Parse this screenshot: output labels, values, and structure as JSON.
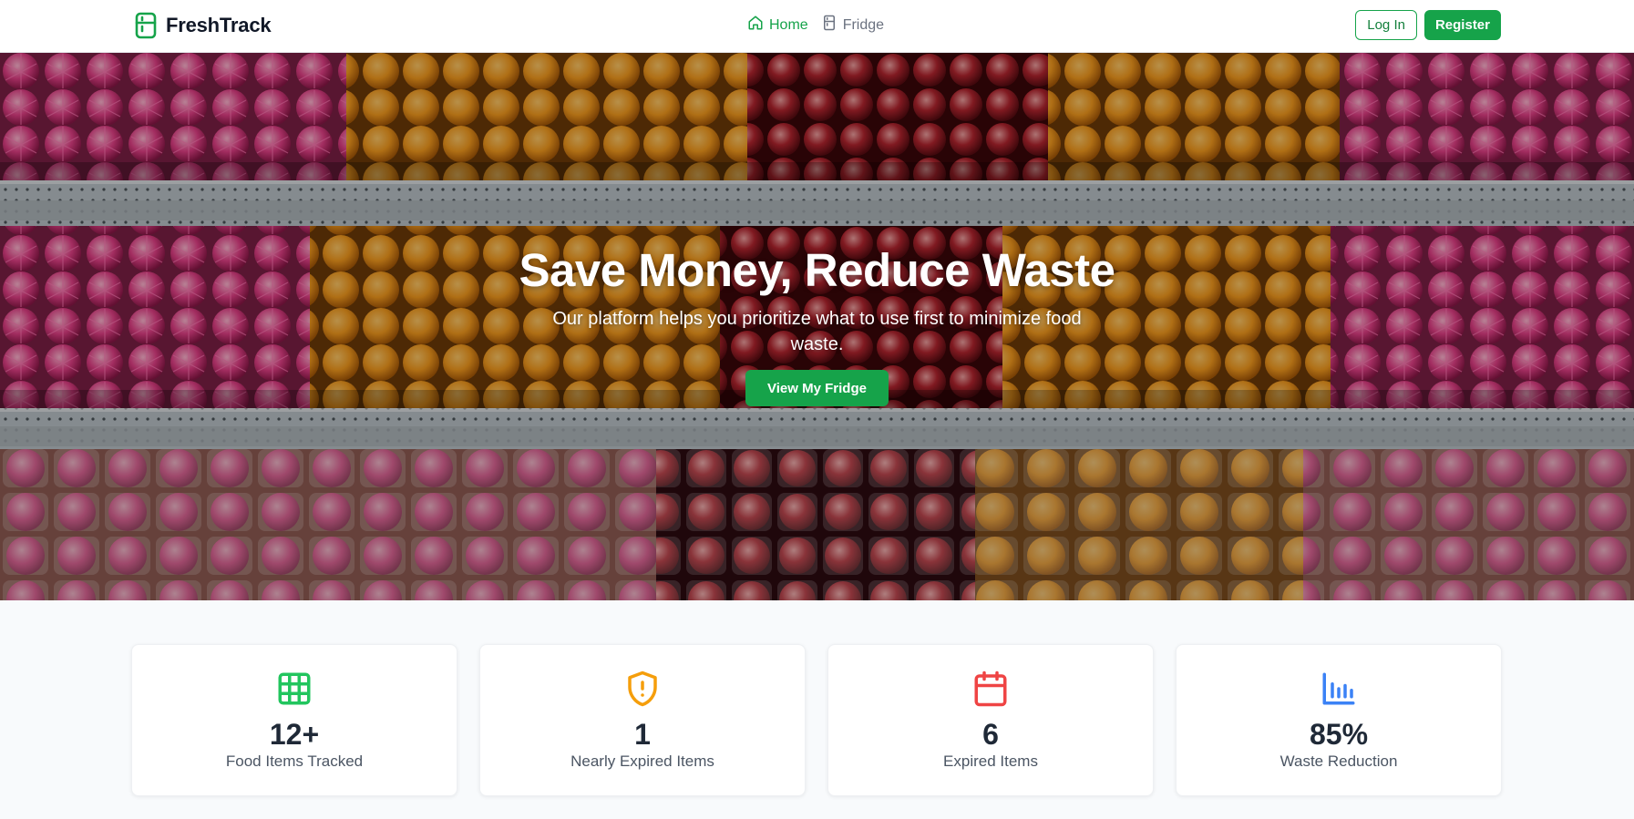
{
  "brand": {
    "name": "FreshTrack",
    "logo_icon": "fridge-icon",
    "color": "#16a34a"
  },
  "nav": {
    "items": [
      {
        "label": "Home",
        "icon": "home-icon",
        "active": true
      },
      {
        "label": "Fridge",
        "icon": "fridge-icon",
        "active": false
      }
    ]
  },
  "auth": {
    "login_label": "Log In",
    "register_label": "Register"
  },
  "hero": {
    "title": "Save Money, Reduce Waste",
    "subtitle": "Our platform helps you prioritize what to use first to minimize food waste.",
    "cta_label": "View My Fridge"
  },
  "stats": [
    {
      "value": "12+",
      "label": "Food Items Tracked",
      "icon": "grid-icon",
      "color": "#22c55e"
    },
    {
      "value": "1",
      "label": "Nearly Expired Items",
      "icon": "shield-alert-icon",
      "color": "#f59e0b"
    },
    {
      "value": "6",
      "label": "Expired Items",
      "icon": "calendar-icon",
      "color": "#ef4444"
    },
    {
      "value": "85%",
      "label": "Waste Reduction",
      "icon": "bar-chart-icon",
      "color": "#3b82f6"
    }
  ],
  "colors": {
    "accent": "#16a34a",
    "page_background": "#f8fafc"
  }
}
